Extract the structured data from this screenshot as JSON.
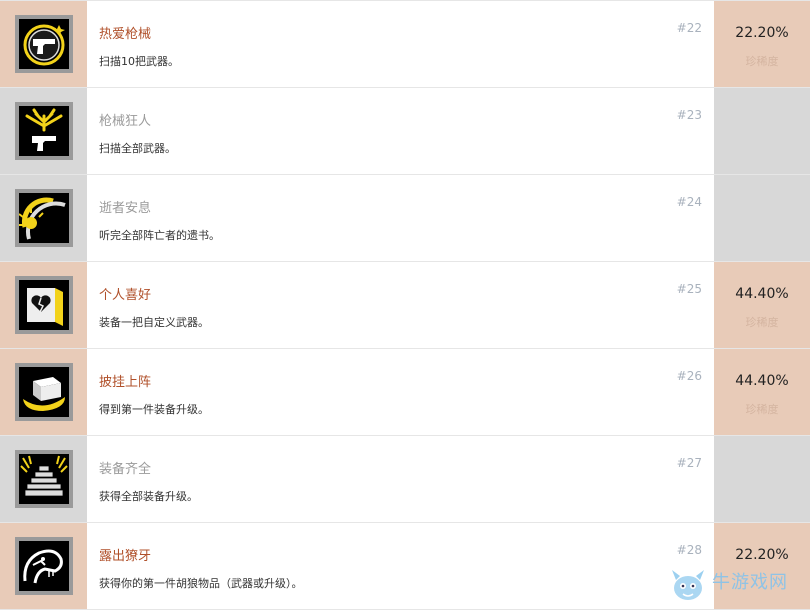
{
  "achievements": [
    {
      "title": "热爱枪械",
      "desc": "扫描10把武器。",
      "num": "#22",
      "pct": "22.20%",
      "rarity": "珍稀度",
      "icon": "pistol-badge-icon",
      "unlocked": true
    },
    {
      "title": "枪械狂人",
      "desc": "扫描全部武器。",
      "num": "#23",
      "pct": "",
      "rarity": "",
      "icon": "antlers-pistol-icon",
      "unlocked": false
    },
    {
      "title": "逝者安息",
      "desc": "听完全部阵亡者的遗书。",
      "num": "#24",
      "pct": "",
      "rarity": "",
      "icon": "sunrise-arc-icon",
      "unlocked": false
    },
    {
      "title": "个人喜好",
      "desc": "装备一把自定义武器。",
      "num": "#25",
      "pct": "44.40%",
      "rarity": "珍稀度",
      "icon": "broken-heart-door-icon",
      "unlocked": true
    },
    {
      "title": "披挂上阵",
      "desc": "得到第一件装备升级。",
      "num": "#26",
      "pct": "44.40%",
      "rarity": "珍稀度",
      "icon": "crate-icon",
      "unlocked": true
    },
    {
      "title": "装备齐全",
      "desc": "获得全部装备升级。",
      "num": "#27",
      "pct": "",
      "rarity": "",
      "icon": "crate-stack-icon",
      "unlocked": false
    },
    {
      "title": "露出獠牙",
      "desc": "获得你的第一件胡狼物品（武器或升级）。",
      "num": "#28",
      "pct": "22.20%",
      "rarity": "",
      "icon": "snake-head-icon",
      "unlocked": true
    }
  ],
  "watermark": {
    "text": "牛游戏网",
    "icon": "mascot-icon"
  },
  "colors": {
    "unlocked_bg": "#e8cbb8",
    "locked_bg": "#d8d8d8",
    "title_unlocked": "#b0502a",
    "title_locked": "#9b9b9b",
    "rarity": "#d4b4a0"
  }
}
